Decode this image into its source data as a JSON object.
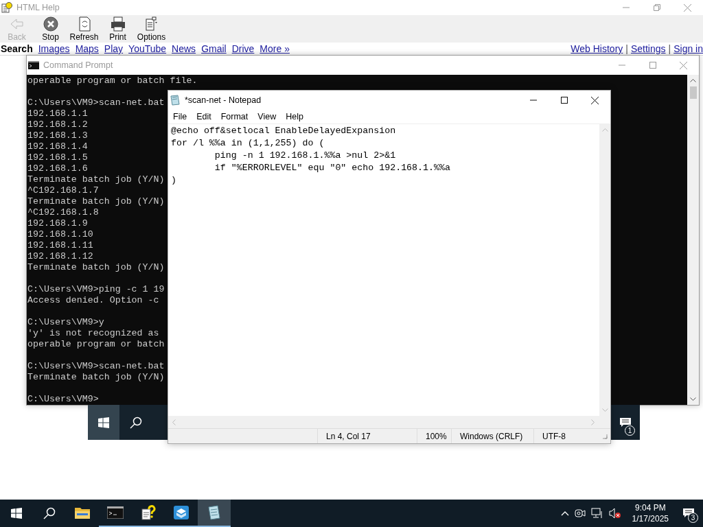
{
  "help_window": {
    "title": "HTML Help",
    "toolbar": [
      {
        "kind": "back",
        "label": "Back",
        "disabled": true
      },
      {
        "kind": "stop",
        "label": "Stop",
        "disabled": false
      },
      {
        "kind": "refresh",
        "label": "Refresh",
        "disabled": false
      },
      {
        "kind": "print",
        "label": "Print",
        "disabled": false
      },
      {
        "kind": "options",
        "label": "Options",
        "disabled": false
      }
    ],
    "nav_links": [
      {
        "label": "Search",
        "selected": true
      },
      {
        "label": "Images",
        "selected": false
      },
      {
        "label": "Maps",
        "selected": false
      },
      {
        "label": "Play",
        "selected": false
      },
      {
        "label": "YouTube",
        "selected": false
      },
      {
        "label": "News",
        "selected": false
      },
      {
        "label": "Gmail",
        "selected": false
      },
      {
        "label": "Drive",
        "selected": false
      },
      {
        "label": "More »",
        "selected": false
      }
    ],
    "account_links": [
      {
        "kind": "link",
        "label": "Web History"
      },
      {
        "kind": "separator",
        "label": "|"
      },
      {
        "kind": "link",
        "label": "Settings"
      },
      {
        "kind": "separator",
        "label": "|"
      },
      {
        "kind": "link",
        "label": "Sign in"
      }
    ]
  },
  "cmd_window": {
    "title": "Command Prompt",
    "blocks": [
      {
        "lines": [
          {
            "text": "operable program or batch file."
          }
        ]
      },
      {
        "lines": [
          {
            "text": "C:\\Users\\VM9>scan-net.bat"
          },
          {
            "text": "192.168.1.1"
          },
          {
            "text": "192.168.1.2"
          },
          {
            "text": "192.168.1.3"
          },
          {
            "text": "192.168.1.4"
          },
          {
            "text": "192.168.1.5"
          },
          {
            "text": "192.168.1.6"
          },
          {
            "text": "Terminate batch job (Y/N)"
          },
          {
            "text": "^C192.168.1.7"
          },
          {
            "text": "Terminate batch job (Y/N)"
          },
          {
            "text": "^C192.168.1.8"
          },
          {
            "text": "192.168.1.9"
          },
          {
            "text": "192.168.1.10"
          },
          {
            "text": "192.168.1.11"
          },
          {
            "text": "192.168.1.12"
          },
          {
            "text": "Terminate batch job (Y/N)"
          }
        ]
      },
      {
        "lines": [
          {
            "text": "C:\\Users\\VM9>ping -c 1 19"
          },
          {
            "text": "Access denied. Option -c"
          }
        ]
      },
      {
        "lines": [
          {
            "text": "C:\\Users\\VM9>y"
          },
          {
            "text": "'y' is not recognized as"
          },
          {
            "text": "operable program or batch"
          }
        ]
      },
      {
        "lines": [
          {
            "text": "C:\\Users\\VM9>scan-net.bat"
          },
          {
            "text": "Terminate batch job (Y/N)"
          }
        ]
      },
      {
        "lines": [
          {
            "text": "C:\\Users\\VM9>"
          }
        ]
      }
    ]
  },
  "vm_taskbar": {
    "notification_count": "1"
  },
  "notepad": {
    "title": "*scan-net - Notepad",
    "menu": [
      "File",
      "Edit",
      "Format",
      "View",
      "Help"
    ],
    "lines": [
      "@echo off&setlocal EnableDelayedExpansion",
      "for /l %%a in (1,1,255) do (",
      "\tping -n 1 192.168.1.%%a >nul 2>&1",
      "\tif \"%ERRORLEVEL\" equ \"0\" echo 192.168.1.%%a",
      ")"
    ],
    "status": [
      "Ln 4, Col 17",
      "100%",
      "Windows (CRLF)",
      "UTF-8"
    ]
  },
  "taskbar": {
    "apps": [
      {
        "kind": "folder",
        "running": false,
        "active": false
      },
      {
        "kind": "terminal",
        "running": true,
        "active": false
      },
      {
        "kind": "help",
        "running": true,
        "active": false
      },
      {
        "kind": "box",
        "running": true,
        "active": false
      },
      {
        "kind": "notepad",
        "running": true,
        "active": true
      }
    ],
    "time": "9:04 PM",
    "date": "1/17/2025",
    "notification_count": "3"
  }
}
